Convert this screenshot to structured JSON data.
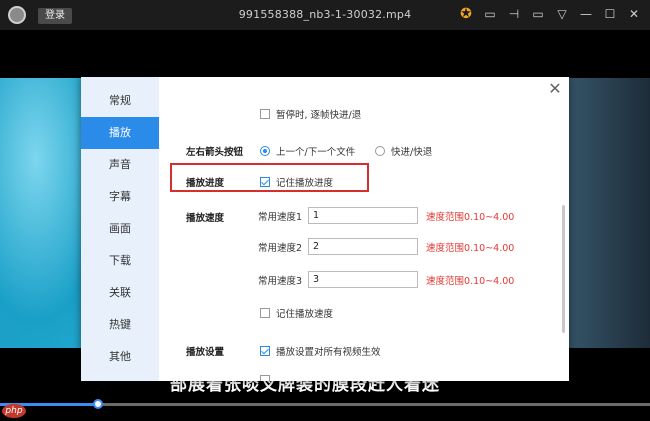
{
  "titlebar": {
    "login": "登录",
    "title": "991558388_nb3-1-30032.mp4"
  },
  "settings": {
    "sidebar": [
      "常规",
      "播放",
      "声音",
      "字幕",
      "画面",
      "下载",
      "关联",
      "热键",
      "其他"
    ],
    "pause_frame": "暂停时, 逐帧快进/退",
    "arrow_keys": {
      "label": "左右箭头按钮",
      "opt1": "上一个/下一个文件",
      "opt2": "快进/快退"
    },
    "progress": {
      "label": "播放进度",
      "check": "记住播放进度"
    },
    "speed": {
      "label": "播放速度",
      "rows": [
        {
          "name": "常用速度1",
          "value": "1",
          "range": "速度范围0.10~4.00"
        },
        {
          "name": "常用速度2",
          "value": "2",
          "range": "速度范围0.10~4.00"
        },
        {
          "name": "常用速度3",
          "value": "3",
          "range": "速度范围0.10~4.00"
        }
      ],
      "remember": "记住播放速度"
    },
    "play_settings": {
      "label": "播放设置",
      "check": "播放设置对所有视频生效"
    }
  },
  "subtitle": "部展着张啖叉牌装的膜段赶人着迷",
  "watermark": "php"
}
